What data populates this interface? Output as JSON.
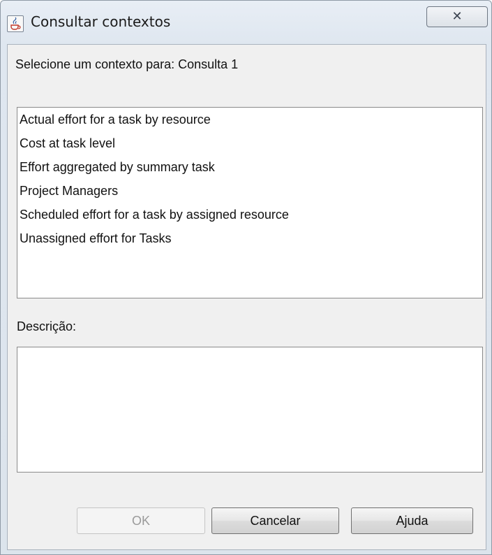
{
  "window": {
    "title": "Consultar contextos",
    "close_glyph": "✕",
    "icon": "java-cup-icon"
  },
  "prompt": {
    "label": "Selecione um contexto para: Consulta 1"
  },
  "contexts": {
    "items": [
      "Actual effort for a task by resource",
      "Cost at task level",
      "Effort aggregated by summary task",
      "Project Managers",
      "Scheduled effort for a task by assigned resource",
      "Unassigned effort for Tasks"
    ]
  },
  "description": {
    "label": "Descrição:",
    "value": ""
  },
  "buttons": {
    "ok": "OK",
    "ok_enabled": false,
    "cancel": "Cancelar",
    "help": "Ajuda"
  },
  "colors": {
    "window_frame": "#dce4ec",
    "client_background": "#f0f0f0",
    "list_background": "#ffffff",
    "disabled_text": "#9a9a9a"
  }
}
